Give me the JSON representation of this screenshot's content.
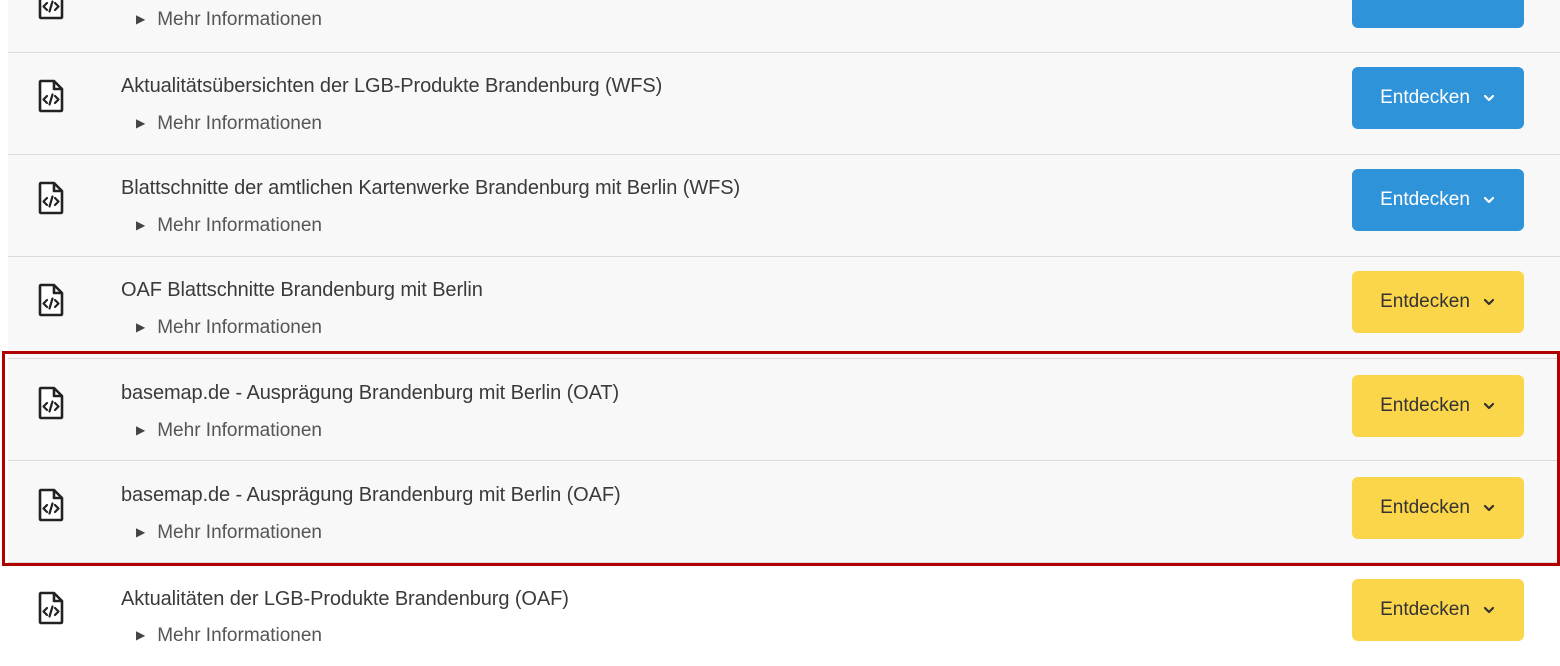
{
  "items": [
    {
      "title": "",
      "more": "Mehr Informationen",
      "button": "",
      "button_color": "#2e93d8",
      "icon": "code-file-icon"
    },
    {
      "title": "Aktualitätsübersichten der LGB-Produkte Brandenburg (WFS)",
      "more": "Mehr Informationen",
      "button": "Entdecken",
      "button_color": "#2e93d8",
      "icon": "code-file-icon"
    },
    {
      "title": "Blattschnitte der amtlichen Kartenwerke Brandenburg mit Berlin (WFS)",
      "more": "Mehr Informationen",
      "button": "Entdecken",
      "button_color": "#2e93d8",
      "icon": "code-file-icon"
    },
    {
      "title": "OAF Blattschnitte Brandenburg mit Berlin",
      "more": "Mehr Informationen",
      "button": "Entdecken",
      "button_color": "#fbd54a",
      "icon": "code-file-icon"
    },
    {
      "title": "basemap.de - Ausprägung Brandenburg mit Berlin (OAT)",
      "more": "Mehr Informationen",
      "button": "Entdecken",
      "button_color": "#fbd54a",
      "icon": "code-file-icon"
    },
    {
      "title": "basemap.de - Ausprägung Brandenburg mit Berlin (OAF)",
      "more": "Mehr Informationen",
      "button": "Entdecken",
      "button_color": "#fbd54a",
      "icon": "code-file-icon"
    },
    {
      "title": "Aktualitäten der LGB-Produkte Brandenburg (OAF)",
      "more": "Mehr Informationen",
      "button": "Entdecken",
      "button_color": "#fbd54a",
      "icon": "code-file-icon"
    }
  ],
  "highlight_color": "#b00000"
}
